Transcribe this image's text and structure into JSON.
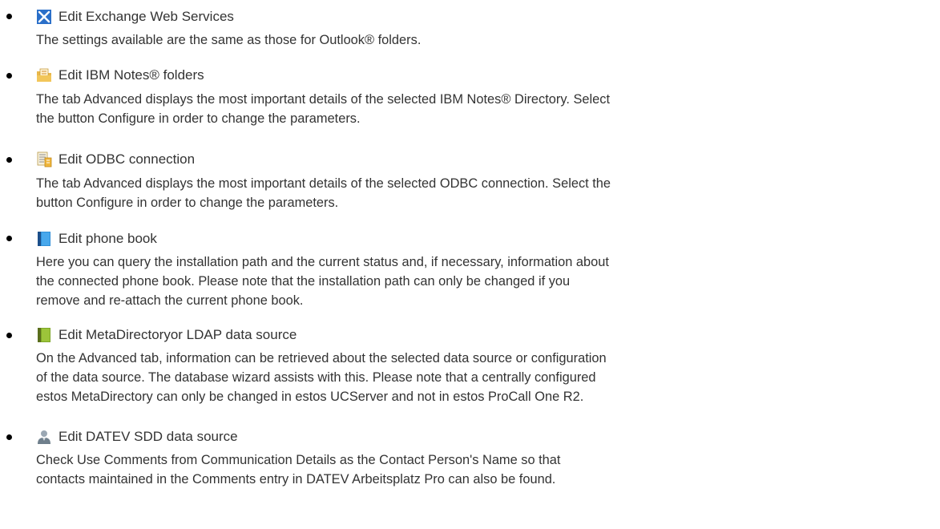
{
  "items": [
    {
      "icon": "exchange-web-services-icon",
      "title": "Edit Exchange Web Services",
      "lines": [
        "The settings available are the same as those for Outlook® folders."
      ]
    },
    {
      "icon": "ibm-notes-folder-icon",
      "title": "Edit IBM Notes® folders",
      "lines": [
        "The tab Advanced displays the most important details of the selected IBM Notes® Directory. Select",
        "the button Configure in order to change the parameters."
      ]
    },
    {
      "icon": "odbc-connection-icon",
      "title": "Edit ODBC connection",
      "lines": [
        "The tab Advanced displays the most important details of the selected ODBC connection. Select the",
        "button Configure in order to change the parameters."
      ]
    },
    {
      "icon": "phone-book-icon",
      "title": "Edit phone book",
      "lines": [
        "Here you can query the installation  path and the current status and, if necessary, information about",
        "the connected phone book. Please note that the installation path can only be changed if you",
        "remove and re-attach the current phone book."
      ]
    },
    {
      "icon": "metadirectory-ldap-icon",
      "title": "Edit MetaDirectoryor LDAP data source",
      "lines": [
        "On the Advanced tab, information can be retrieved about the selected  data source or configuration",
        "of the data source. The database wizard assists with this. Please note that a centrally configured",
        "estos MetaDirectory can only be changed in estos UCServer and not in estos ProCall One R2."
      ]
    },
    {
      "icon": "datev-sdd-person-icon",
      "title": "Edit DATEV SDD data source",
      "lines": [
        "Check Use Comments from Communication Details as the Contact Person's Name so that",
        "contacts maintained in the Comments entry in DATEV Arbeitsplatz Pro can also be found."
      ]
    }
  ]
}
